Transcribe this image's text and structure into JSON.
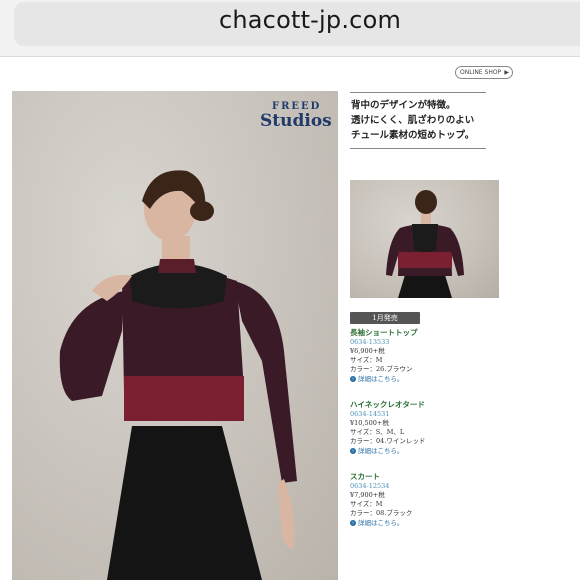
{
  "browser": {
    "url": "chacott-jp.com"
  },
  "header": {
    "online_shop_label": "ONLINE SHOP",
    "online_shop_arrow": "▶"
  },
  "hero": {
    "brand_top": "FREED",
    "brand_main": "Studios"
  },
  "tagline": {
    "lines": [
      "背中のデザインが特徴。",
      "透けにくく、肌ざわりのよい",
      "チュール素材の短めトップ。"
    ]
  },
  "release_badge": "1月発売",
  "products": [
    {
      "name": "長袖ショートトップ",
      "code": "0634-13533",
      "price": "¥6,900+税",
      "size": "サイズ：M",
      "color": "カラー：26.ブラウン",
      "link": "詳細はこちら。"
    },
    {
      "name": "ハイネックレオタード",
      "code": "0634-14531",
      "price": "¥10,500+税",
      "size": "サイズ：S、M、L",
      "color": "カラー：04.ワインレッド",
      "link": "詳細はこちら。"
    },
    {
      "name": "スカート",
      "code": "0634-12534",
      "price": "¥7,900+税",
      "size": "サイズ：M",
      "color": "カラー：08.ブラック",
      "link": "詳細はこちら。"
    }
  ],
  "colors": {
    "brand_blue": "#1f3a6b",
    "product_name_green": "#2b6d34",
    "code_blue": "#4a8fb8",
    "garment_burgundy": "#3a1a26",
    "garment_wine": "#7a2030"
  },
  "icons": {
    "link_icon": "circle-arrow-icon"
  }
}
